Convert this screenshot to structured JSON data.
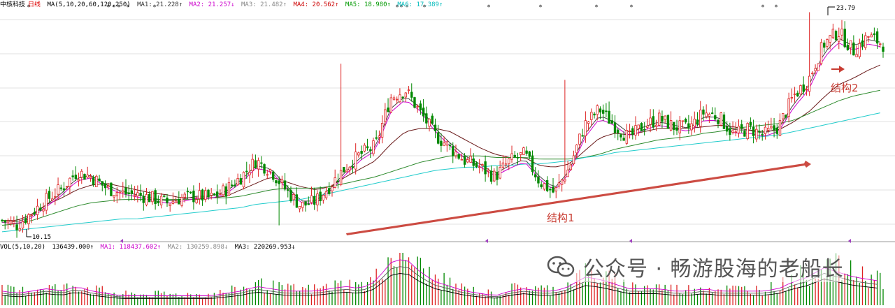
{
  "header": {
    "stock_name": "中核科技",
    "period": "日线",
    "ma_params": "MA(5,10,20,60,120,250)",
    "ma_values": [
      {
        "label": "MA1: 21.228↑",
        "color": "#333333"
      },
      {
        "label": "MA2: 21.257↓",
        "color": "#cc00cc"
      },
      {
        "label": "MA3: 21.482↑",
        "color": "#888888"
      },
      {
        "label": "MA4: 20.562↑",
        "color": "#cc0000"
      },
      {
        "label": "MA5: 18.980↑",
        "color": "#009900"
      },
      {
        "label": "MA6: 17.389↑",
        "color": "#00bbbb"
      }
    ]
  },
  "volume_header": {
    "params": "VOL(5,10,20)",
    "value": "136439.000↑",
    "ma_values": [
      {
        "label": "MA1: 118437.602↑",
        "color": "#cc00cc"
      },
      {
        "label": "MA2: 130259.898↓",
        "color": "#888888"
      },
      {
        "label": "MA3: 220269.953↓",
        "color": "#000000"
      }
    ]
  },
  "annotations": {
    "low_label": "10.15",
    "high_label": "23.79",
    "structure1": "结构1",
    "structure2": "结构2"
  },
  "watermark": "公众号 · 畅游股海的老船长",
  "colors": {
    "up": "#dd2222",
    "down": "#008800",
    "arrow": "#c83c32",
    "ma5": "#444444",
    "ma10": "#cc00cc",
    "ma20": "#777777",
    "ma60": "#6a1a1a",
    "ma120": "#2e8b2e",
    "ma250": "#22cccc",
    "grid": "#d8d8d8"
  },
  "chart_data": {
    "type": "candlestick",
    "price_range": [
      10.15,
      23.79
    ],
    "close_path": [
      10.9,
      10.6,
      11.4,
      12.2,
      12.9,
      13.9,
      13.6,
      12.9,
      12.6,
      12.5,
      12.3,
      12.0,
      12.3,
      12.4,
      12.3,
      12.8,
      13.6,
      14.6,
      14.0,
      12.8,
      11.8,
      12.1,
      13.1,
      14.2,
      15.0,
      15.5,
      18.5,
      19.0,
      17.6,
      16.2,
      15.4,
      14.6,
      14.2,
      13.6,
      14.6,
      15.0,
      13.3,
      12.6,
      14.2,
      16.8,
      17.8,
      16.8,
      16.0,
      16.8,
      17.2,
      16.7,
      16.6,
      17.6,
      17.3,
      16.2,
      16.6,
      16.2,
      16.7,
      18.6,
      19.6,
      21.8,
      22.6,
      21.4,
      22.3,
      21.8
    ],
    "moving_averages": [
      {
        "name": "MA5",
        "values": [
          10.9,
          10.8,
          11.2,
          11.9,
          12.6,
          13.5,
          13.7,
          13.1,
          12.7,
          12.5,
          12.3,
          12.1,
          12.2,
          12.4,
          12.4,
          12.7,
          13.4,
          14.3,
          14.1,
          13.1,
          12.1,
          12.1,
          12.9,
          13.9,
          14.8,
          15.4,
          17.8,
          18.6,
          17.9,
          16.6,
          15.7,
          14.9,
          14.4,
          13.8,
          14.3,
          14.7,
          13.6,
          12.9,
          14.0,
          16.2,
          17.4,
          17.0,
          16.3,
          16.7,
          17.0,
          16.8,
          16.6,
          17.3,
          17.3,
          16.5,
          16.5,
          16.3,
          16.6,
          18.1,
          19.2,
          21.2,
          22.2,
          21.7,
          22.1,
          21.9
        ]
      },
      {
        "name": "MA60",
        "values": [
          10.9,
          10.9,
          11.3,
          11.9,
          12.3,
          12.8,
          13.1,
          13.2,
          13.0,
          12.8,
          12.6,
          12.5,
          12.3,
          12.3,
          12.3,
          12.4,
          12.8,
          13.2,
          13.6,
          13.3,
          13.0,
          12.8,
          13.0,
          13.6,
          14.1,
          14.6,
          15.6,
          16.4,
          16.6,
          16.6,
          16.4,
          15.9,
          15.4,
          15.0,
          14.8,
          14.8,
          14.3,
          14.2,
          14.4,
          15.2,
          16.0,
          16.3,
          16.2,
          16.4,
          16.6,
          16.6,
          16.6,
          16.7,
          16.8,
          16.7,
          16.5,
          16.4,
          16.5,
          17.0,
          17.6,
          18.5,
          19.3,
          19.7,
          20.2,
          20.6
        ]
      },
      {
        "name": "MA120",
        "values": [
          10.6,
          10.7,
          10.9,
          11.2,
          11.5,
          11.8,
          12.0,
          12.1,
          12.2,
          12.2,
          12.2,
          12.2,
          12.2,
          12.2,
          12.3,
          12.3,
          12.4,
          12.6,
          12.8,
          12.9,
          12.9,
          12.9,
          13.0,
          13.2,
          13.4,
          13.6,
          13.9,
          14.2,
          14.5,
          14.7,
          14.9,
          14.9,
          14.9,
          14.8,
          14.8,
          14.8,
          14.7,
          14.7,
          14.7,
          14.8,
          15.0,
          15.3,
          15.5,
          15.7,
          15.9,
          16.0,
          16.1,
          16.3,
          16.4,
          16.6,
          16.7,
          16.8,
          16.9,
          17.1,
          17.5,
          17.9,
          18.3,
          18.6,
          18.8,
          19.0
        ]
      },
      {
        "name": "MA250",
        "values": [
          10.2,
          10.3,
          10.4,
          10.5,
          10.6,
          10.7,
          10.8,
          10.9,
          11.0,
          11.0,
          11.1,
          11.2,
          11.3,
          11.4,
          11.5,
          11.6,
          11.7,
          11.9,
          12.0,
          12.1,
          12.2,
          12.4,
          12.6,
          12.8,
          13.0,
          13.2,
          13.4,
          13.6,
          13.8,
          14.0,
          14.1,
          14.2,
          14.2,
          14.3,
          14.3,
          14.4,
          14.4,
          14.5,
          14.6,
          14.8,
          14.9,
          15.1,
          15.2,
          15.3,
          15.4,
          15.5,
          15.6,
          15.7,
          15.8,
          15.9,
          16.0,
          16.1,
          16.2,
          16.4,
          16.6,
          16.8,
          17.0,
          17.2,
          17.4,
          17.6
        ]
      }
    ],
    "volume_relative": [
      0.3,
      0.25,
      0.3,
      0.35,
      0.3,
      0.4,
      0.3,
      0.25,
      0.2,
      0.2,
      0.2,
      0.2,
      0.2,
      0.2,
      0.2,
      0.25,
      0.3,
      0.4,
      0.35,
      0.3,
      0.3,
      0.3,
      0.35,
      0.4,
      0.35,
      0.5,
      0.9,
      1.0,
      0.7,
      0.5,
      0.4,
      0.3,
      0.25,
      0.2,
      0.3,
      0.35,
      0.3,
      0.3,
      0.4,
      0.6,
      0.55,
      0.45,
      0.35,
      0.35,
      0.35,
      0.3,
      0.3,
      0.35,
      0.3,
      0.3,
      0.3,
      0.3,
      0.35,
      0.5,
      0.6,
      0.8,
      0.7,
      0.6,
      0.55,
      0.5
    ]
  }
}
